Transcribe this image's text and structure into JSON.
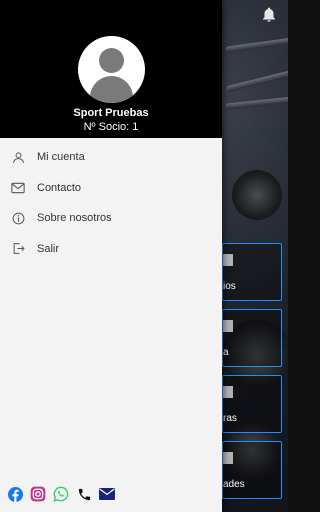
{
  "drawer": {
    "user_name": "Sport Pruebas",
    "member_number": "Nº Socio: 1",
    "menu": [
      {
        "label": "Mi cuenta",
        "icon": "user-icon"
      },
      {
        "label": "Contacto",
        "icon": "mail-icon"
      },
      {
        "label": "Sobre nosotros",
        "icon": "info-icon"
      },
      {
        "label": "Salir",
        "icon": "logout-icon"
      }
    ],
    "social": [
      "facebook-icon",
      "instagram-icon",
      "whatsapp-icon",
      "phone-icon",
      "email-icon"
    ]
  },
  "background": {
    "tiles": [
      "ios",
      "a",
      "ras",
      "ades"
    ]
  },
  "colors": {
    "drawer_header": "#000000",
    "drawer_bg": "#f3f3f3",
    "tile_border": "#1e90ff",
    "facebook": "#1877f2",
    "instagram": "#c13584",
    "whatsapp": "#25d366",
    "email": "#1a237e"
  }
}
